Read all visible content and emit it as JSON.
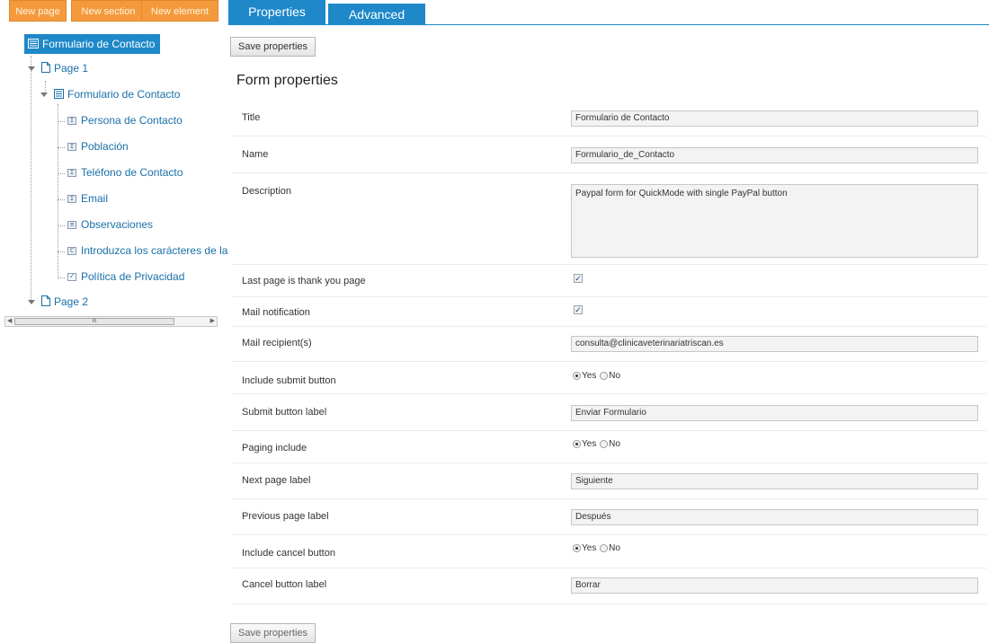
{
  "toolbar": {
    "new_page": "New page",
    "new_section": "New section",
    "new_element": "New element"
  },
  "tree": {
    "root": "Formulario de Contacto",
    "page1": "Page 1",
    "form": "Formulario de Contacto",
    "fields": [
      {
        "label": "Persona de Contacto",
        "icon": "text-field-icon"
      },
      {
        "label": "Población",
        "icon": "text-field-icon"
      },
      {
        "label": "Teléfono de Contacto",
        "icon": "text-field-icon"
      },
      {
        "label": "Email",
        "icon": "text-field-icon"
      },
      {
        "label": "Observaciones",
        "icon": "textarea-field-icon"
      },
      {
        "label": "Introduzca los carácteres de la",
        "icon": "captcha-field-icon"
      },
      {
        "label": "Política de Privacidad",
        "icon": "checkbox-field-icon"
      }
    ],
    "page2": "Page 2",
    "scroll_thumb": "III"
  },
  "tabs": {
    "properties": "Properties",
    "advanced": "Advanced"
  },
  "buttons": {
    "save_top": "Save properties",
    "save_bottom": "Save properties"
  },
  "section_title": "Form properties",
  "form": {
    "title_label": "Title",
    "title_value": "Formulario de Contacto",
    "name_label": "Name",
    "name_value": "Formulario_de_Contacto",
    "description_label": "Description",
    "description_value": "Paypal form for QuickMode with single PayPal button",
    "thankyou_label": "Last page is thank you page",
    "thankyou_checked": true,
    "mailnotif_label": "Mail notification",
    "mailnotif_checked": true,
    "recipients_label": "Mail recipient(s)",
    "recipients_value": "consulta@clinicaveterinariatriscan.es",
    "submit_incl_label": "Include submit button",
    "submit_label_label": "Submit button label",
    "submit_label_value": "Enviar Formulario",
    "paging_label": "Paging include",
    "next_label": "Next page label",
    "next_value": "Siguiente",
    "prev_label": "Previous page label",
    "prev_value": "Después",
    "cancel_incl_label": "Include cancel button",
    "cancel_label_label": "Cancel button label",
    "cancel_label_value": "Borrar",
    "yes": "Yes",
    "no": "No"
  },
  "colors": {
    "accent": "#1e88c9",
    "toolbar": "#f49a3d",
    "link": "#1a6fa8"
  }
}
